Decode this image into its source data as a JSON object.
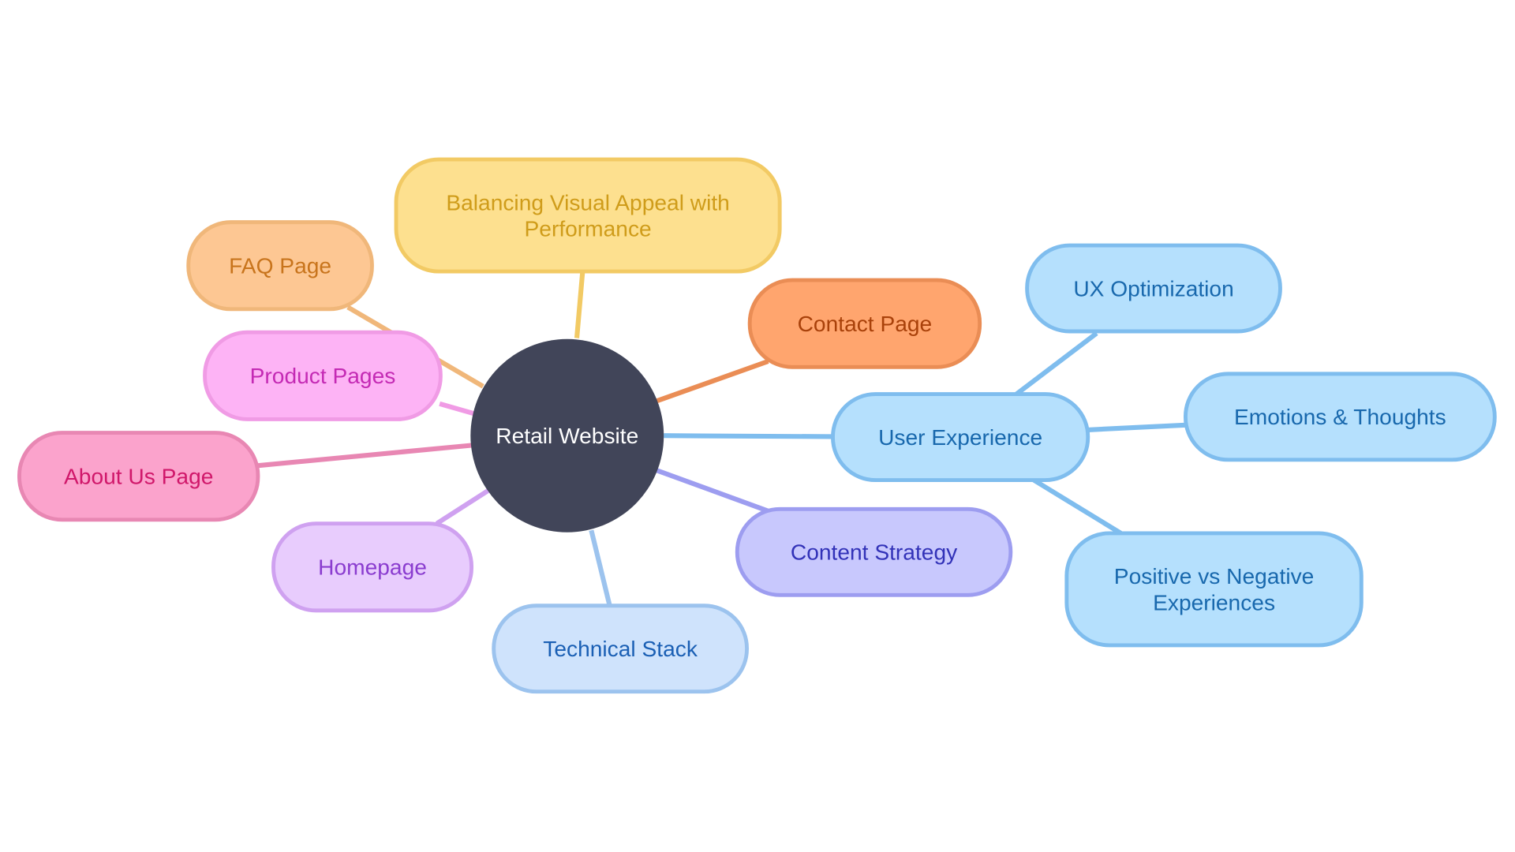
{
  "root": {
    "label": "Retail Website",
    "fill": "#414559",
    "text_color": "#ffffff"
  },
  "nodes": [
    {
      "id": "balancing",
      "lines": [
        "Balancing Visual Appeal with",
        "Performance"
      ],
      "fill": "#fde08f",
      "stroke": "#f2ca64",
      "text_color": "#cf9c1a",
      "parent": "root"
    },
    {
      "id": "faq",
      "lines": [
        "FAQ Page"
      ],
      "fill": "#fdc793",
      "stroke": "#f0b77a",
      "text_color": "#c8741c",
      "parent": "root"
    },
    {
      "id": "product",
      "lines": [
        "Product Pages"
      ],
      "fill": "#fdb3f5",
      "stroke": "#f09be5",
      "text_color": "#c42ab4",
      "parent": "root"
    },
    {
      "id": "about",
      "lines": [
        "About Us Page"
      ],
      "fill": "#fba3cc",
      "stroke": "#e887b3",
      "text_color": "#d0176a",
      "parent": "root"
    },
    {
      "id": "homepage",
      "lines": [
        "Homepage"
      ],
      "fill": "#e8ccfd",
      "stroke": "#cfa1f0",
      "text_color": "#8a3ccf",
      "parent": "root"
    },
    {
      "id": "technical",
      "lines": [
        "Technical Stack"
      ],
      "fill": "#cfe3fc",
      "stroke": "#9cc3ee",
      "text_color": "#1a5fb4",
      "parent": "root"
    },
    {
      "id": "content",
      "lines": [
        "Content Strategy"
      ],
      "fill": "#c8c8fd",
      "stroke": "#9d9df0",
      "text_color": "#3232b8",
      "parent": "root"
    },
    {
      "id": "contact",
      "lines": [
        "Contact Page"
      ],
      "fill": "#ffa56e",
      "stroke": "#ea8d55",
      "text_color": "#a9410a",
      "parent": "root"
    },
    {
      "id": "ux",
      "lines": [
        "User Experience"
      ],
      "fill": "#b5e0fd",
      "stroke": "#7fbdee",
      "text_color": "#1868ad",
      "parent": "root"
    },
    {
      "id": "uxopt",
      "lines": [
        "UX Optimization"
      ],
      "fill": "#b5e0fd",
      "stroke": "#7fbdee",
      "text_color": "#1868ad",
      "parent": "ux"
    },
    {
      "id": "emotions",
      "lines": [
        "Emotions & Thoughts"
      ],
      "fill": "#b5e0fd",
      "stroke": "#7fbdee",
      "text_color": "#1868ad",
      "parent": "ux"
    },
    {
      "id": "positive",
      "lines": [
        "Positive vs Negative",
        "Experiences"
      ],
      "fill": "#b5e0fd",
      "stroke": "#7fbdee",
      "text_color": "#1868ad",
      "parent": "ux"
    }
  ]
}
